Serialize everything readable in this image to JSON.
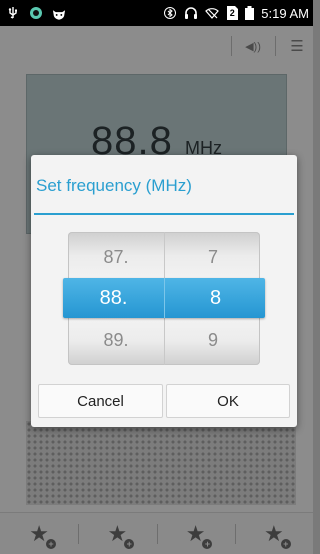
{
  "status_bar": {
    "icons_left": [
      "usb-icon",
      "app-notification-icon",
      "cat-icon"
    ],
    "icons_right": [
      "bluetooth-icon",
      "headset-icon",
      "wifi-off-icon",
      "sim-icon",
      "battery-icon"
    ],
    "sim_badge": "2",
    "time": "5:19 AM"
  },
  "toolbar": {
    "speaker_label": "◀))",
    "menu_label": "☰"
  },
  "radio": {
    "frequency": "88.8",
    "unit": "MHz"
  },
  "dialog": {
    "title": "Set frequency (MHz)",
    "picker": {
      "left_column": {
        "above": "87.",
        "selected": "88.",
        "below": "89."
      },
      "right_column": {
        "above": "7",
        "selected": "8",
        "below": "9"
      }
    },
    "cancel_label": "Cancel",
    "ok_label": "OK",
    "accent_color": "#2a9fd0"
  },
  "favorites": {
    "star": "★",
    "add": "+"
  }
}
